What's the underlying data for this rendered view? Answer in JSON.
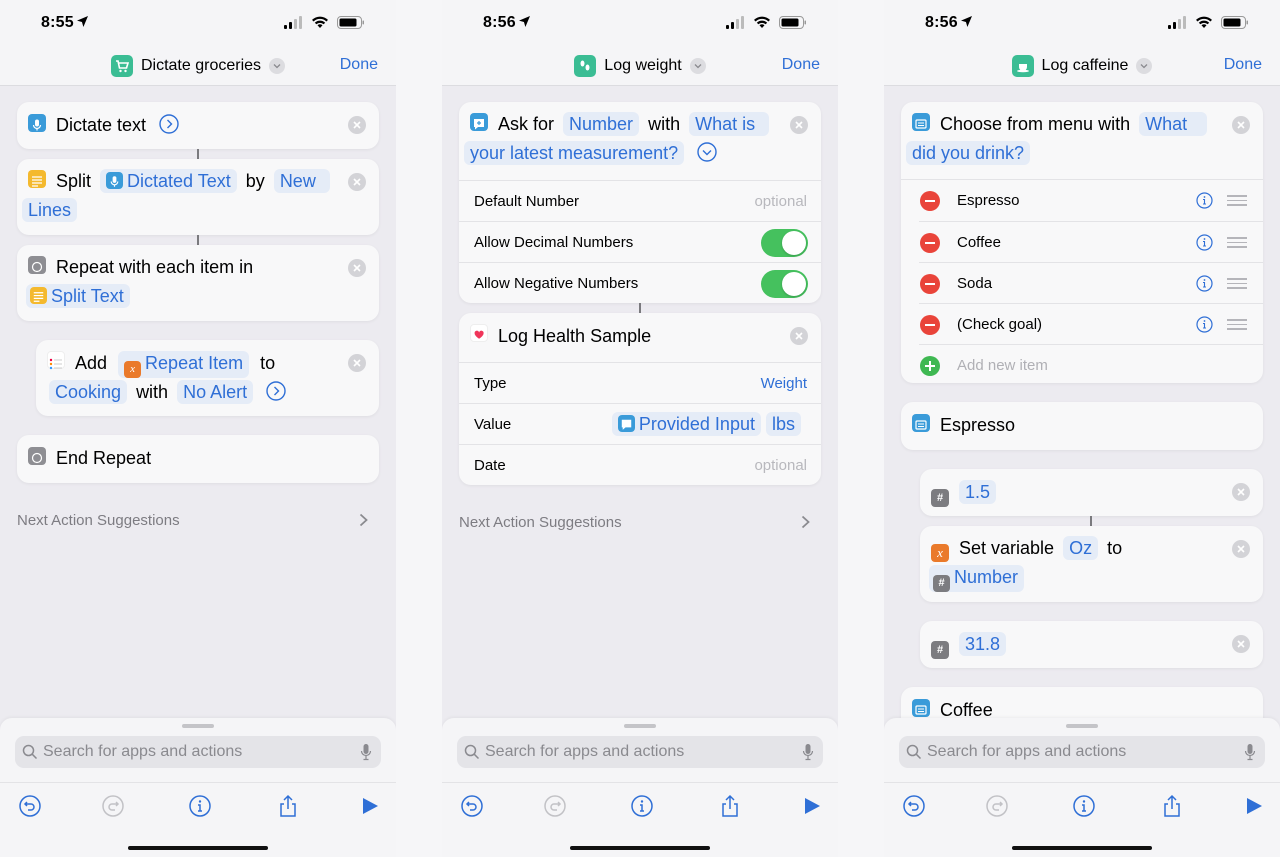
{
  "colors": {
    "accent": "#2f6fd6",
    "toggle_on": "#45c15e",
    "delete": "#e9443a",
    "add": "#3fb852",
    "app_icon": "#3bbd94"
  },
  "phones": [
    {
      "status": {
        "time": "8:55"
      },
      "nav": {
        "title": "Dictate groceries",
        "app_icon": "cart-icon",
        "done_label": "Done"
      },
      "actions": {
        "dictate": {
          "label": "Dictate text",
          "icon": "microphone-icon"
        },
        "split": {
          "verb": "Split",
          "input": "Dictated Text",
          "by": "by",
          "sep1": "New",
          "sep2": "Lines",
          "icon": "text-lines-icon"
        },
        "repeat": {
          "label": "Repeat with each item in",
          "input": "Split Text",
          "icon": "repeat-icon"
        },
        "add": {
          "verb": "Add",
          "item": "Repeat Item",
          "to": "to",
          "list": "Cooking",
          "with": "with",
          "alert": "No Alert",
          "icon": "reminders-list-icon"
        },
        "end_repeat": {
          "label": "End Repeat",
          "icon": "repeat-icon"
        }
      },
      "next_suggestions": "Next Action Suggestions",
      "search": {
        "placeholder": "Search for apps and actions"
      }
    },
    {
      "status": {
        "time": "8:56"
      },
      "nav": {
        "title": "Log weight",
        "app_icon": "footprints-icon",
        "done_label": "Done"
      },
      "ask": {
        "verb": "Ask for",
        "type": "Number",
        "with": "with",
        "prompt1": "What is",
        "prompt2": "your latest measurement?",
        "rows": [
          {
            "label": "Default Number",
            "value": "optional"
          },
          {
            "label": "Allow Decimal Numbers",
            "toggle": true
          },
          {
            "label": "Allow Negative Numbers",
            "toggle": true
          }
        ]
      },
      "health": {
        "title": "Log Health Sample",
        "rows": [
          {
            "label": "Type",
            "value": "Weight"
          },
          {
            "label": "Value",
            "input": "Provided Input",
            "unit": "lbs"
          },
          {
            "label": "Date",
            "value": "optional"
          }
        ]
      },
      "next_suggestions": "Next Action Suggestions",
      "search": {
        "placeholder": "Search for apps and actions"
      }
    },
    {
      "status": {
        "time": "8:56"
      },
      "nav": {
        "title": "Log caffeine",
        "app_icon": "coffee-cup-icon",
        "done_label": "Done"
      },
      "menu": {
        "label": "Choose from menu with",
        "prompt1": "What",
        "prompt2": "did you drink?",
        "items": [
          "Espresso",
          "Coffee",
          "Soda",
          "(Check goal)"
        ],
        "add_placeholder": "Add new item"
      },
      "case_espresso": "Espresso",
      "number1": "1.5",
      "setvar": {
        "label": "Set variable",
        "var": "Oz",
        "to": "to",
        "value": "Number"
      },
      "number2": "31.8",
      "case_coffee": "Coffee",
      "search": {
        "placeholder": "Search for apps and actions"
      }
    }
  ]
}
